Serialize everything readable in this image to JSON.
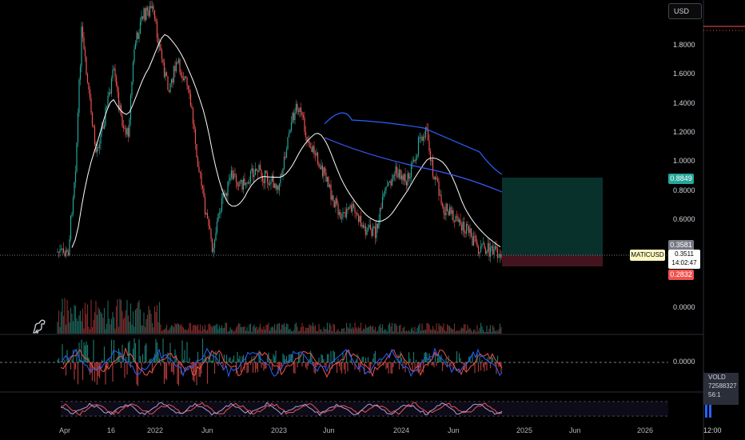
{
  "currency": "USD",
  "ticker": "MATICUSD",
  "price_axis": [
    "1.8000",
    "1.6000",
    "1.4000",
    "1.2000",
    "1.0000",
    "0.8000",
    "0.6000"
  ],
  "volume_axis": "0.0000",
  "oscillator_axis": "0.0000",
  "time_axis": [
    "Apr",
    "16",
    "2022",
    "Jun",
    "2023",
    "Jun",
    "2024",
    "Jun",
    "2025",
    "Jun",
    "2026"
  ],
  "tags": {
    "target": "0.8849",
    "upper": "0.3581",
    "current": "0.3511",
    "countdown": "14:02:47",
    "stop": "0.2832"
  },
  "right_panel": {
    "clock": "12:00",
    "vold_label": "VOLD",
    "vold_value": "72588327",
    "vold_sub": "56:1"
  },
  "colors": {
    "bull": "#26a69a",
    "bear": "#ef5350",
    "target_zone": "#0b3b33",
    "stop_zone": "#4a1620",
    "ma_line": "#ffffff",
    "band_blue": "#2962ff"
  }
}
